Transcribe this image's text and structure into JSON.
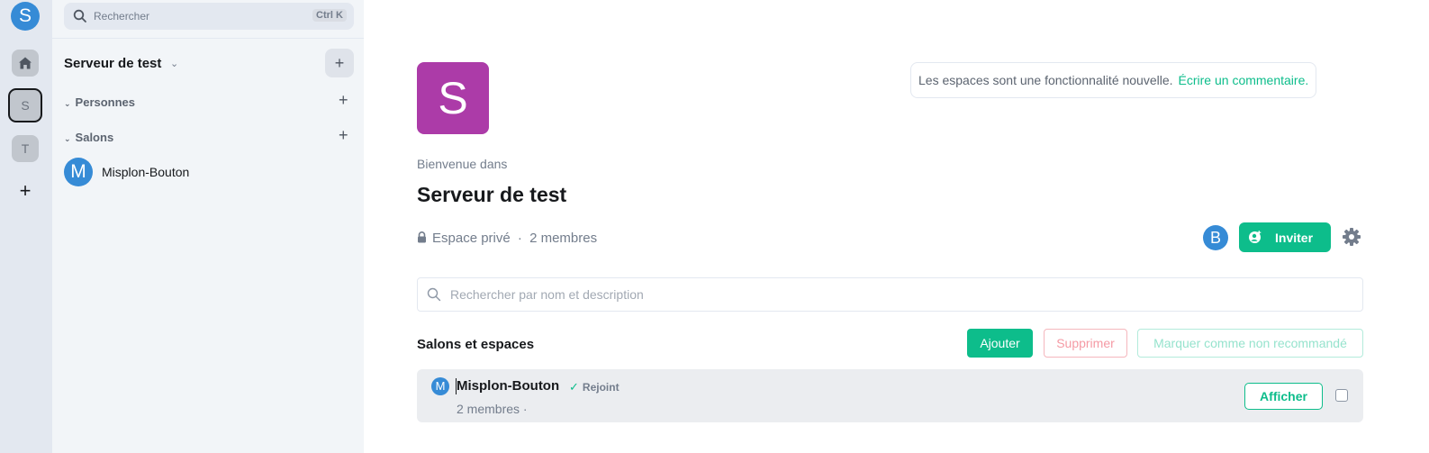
{
  "user": {
    "avatar_letter": "S"
  },
  "spacebar": {
    "spaces": [
      {
        "letter": "S"
      },
      {
        "letter": "T"
      }
    ]
  },
  "search": {
    "placeholder": "Rechercher",
    "shortcut": "Ctrl K"
  },
  "roomlist": {
    "space_name": "Serveur de test",
    "sections": [
      {
        "label": "Personnes"
      },
      {
        "label": "Salons"
      }
    ],
    "rooms": [
      {
        "avatar_letter": "M",
        "name": "Misplon-Bouton"
      }
    ]
  },
  "space_home": {
    "avatar_letter": "S",
    "beta_notice": "Les espaces sont une fonctionnalité nouvelle.",
    "beta_link": "Écrire un commentaire.",
    "welcome": "Bienvenue dans",
    "title": "Serveur de test",
    "visibility": "Espace privé",
    "separator": "·",
    "members": "2 membres",
    "member_avatar_letter": "B",
    "invite_label": "Inviter",
    "filter_placeholder": "Rechercher par nom et description",
    "list_title": "Salons et espaces",
    "buttons": {
      "add": "Ajouter",
      "remove": "Supprimer",
      "unsuggest": "Marquer comme non recommandé"
    },
    "hierarchy": [
      {
        "avatar_letter": "M",
        "name": "Misplon-Bouton",
        "status": "Rejoint",
        "members": "2 membres ·",
        "view_label": "Afficher"
      }
    ]
  },
  "colors": {
    "accent": "#0dbd8b",
    "space_avatar": "#ac3ba8",
    "user_avatar": "#368bd6"
  }
}
